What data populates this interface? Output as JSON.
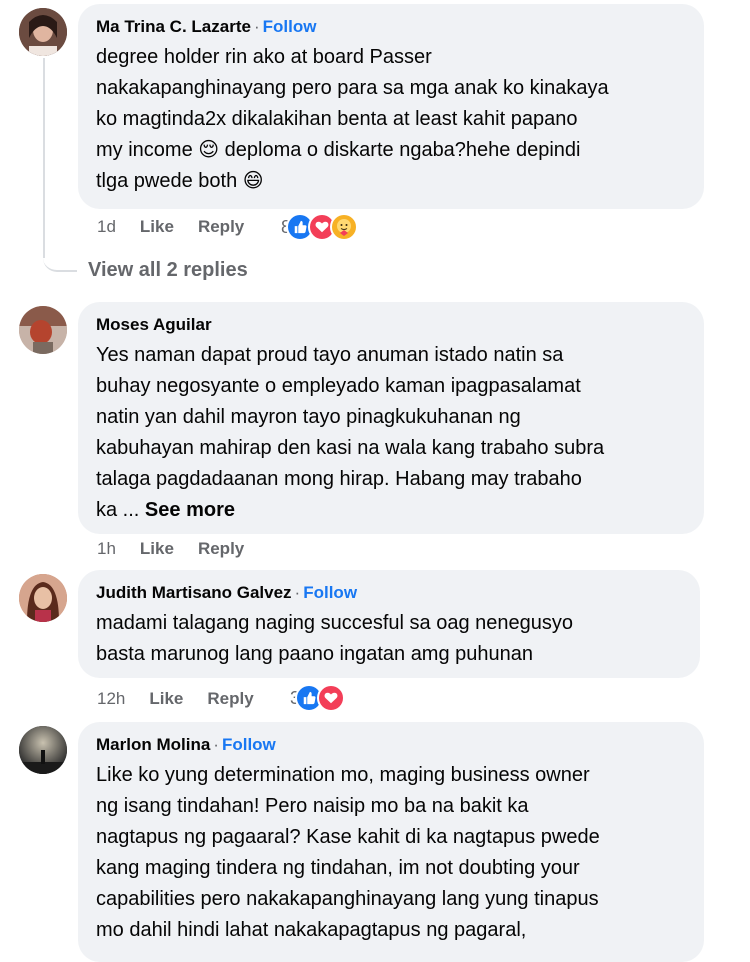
{
  "comments": [
    {
      "author": "Ma Trina C. Lazarte",
      "follow": "Follow",
      "lines": [
        "degree holder rin ako at board Passer",
        "nakakapanghinayang pero para sa mga anak ko kinakaya",
        "ko magtinda2x dikalakihan benta at least kahit papano",
        "my income 😌 deploma o diskarte ngaba?hehe depindi",
        "tlga pwede both 😄"
      ],
      "time": "1d",
      "like": "Like",
      "reply": "Reply",
      "reaction_count": "8",
      "reactions": [
        "like-icon",
        "love-icon",
        "care-icon"
      ],
      "view_replies": "View all 2 replies"
    },
    {
      "author": "Moses Aguilar",
      "lines": [
        "Yes naman dapat proud tayo anuman istado natin sa",
        "buhay negosyante o empleyado kaman ipagpasalamat",
        "natin yan dahil mayron tayo pinagkukuhanan ng",
        "kabuhayan mahirap den kasi na wala kang trabaho subra",
        "talaga pagdadaanan mong hirap. Habang may trabaho",
        "ka ..."
      ],
      "see_more": "See more",
      "time": "1h",
      "like": "Like",
      "reply": "Reply"
    },
    {
      "author": "Judith Martisano Galvez",
      "follow": "Follow",
      "lines": [
        "madami talagang naging succesful sa oag nenegusyo",
        "basta marunog lang paano ingatan amg puhunan"
      ],
      "time": "12h",
      "like": "Like",
      "reply": "Reply",
      "reaction_count": "3",
      "reactions": [
        "like-icon",
        "love-icon"
      ]
    },
    {
      "author": "Marlon Molina",
      "follow": "Follow",
      "lines": [
        "Like ko yung determination mo, maging business owner",
        "ng isang tindahan! Pero naisip mo ba na bakit ka",
        "nagtapus ng pagaaral? Kase kahit di ka nagtapus pwede",
        "kang maging tindera ng tindahan, im not doubting your",
        "capabilities pero nakakapanghinayang lang yung tinapus",
        "mo dahil hindi lahat nakakapagtapus ng pagaral,"
      ]
    }
  ]
}
